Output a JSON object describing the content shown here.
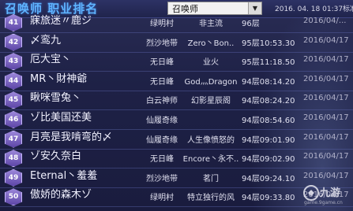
{
  "header": {
    "title": "召唤师 职业排名",
    "dropdown_value": "召唤师",
    "datetime": "2016. 04. 18 01:37标准"
  },
  "rows": [
    {
      "rank": "41",
      "name": "寐旅迷〃鹿ジ",
      "job": "绿明村",
      "cat": "非主流",
      "floor": "96层",
      "date": "2016/04/..."
    },
    {
      "rank": "42",
      "name": "〆鸾九",
      "job": "烈沙地带",
      "cat": "Zero丶Bon..",
      "floor": "95层10:53.30",
      "date": "2016/04/17"
    },
    {
      "rank": "43",
      "name": "厄大宝丶",
      "job": "无日峰",
      "cat": "业火",
      "floor": "95层11:18.50",
      "date": "2016/04/17"
    },
    {
      "rank": "44",
      "name": "MR丶財神爺",
      "job": "无日峰",
      "cat": "God灬Dragon",
      "floor": "94层08:14.20",
      "date": "2016/04/17"
    },
    {
      "rank": "45",
      "name": "瞅咪雪兔丶",
      "job": "白云神师",
      "cat": "幻影星辰阁",
      "floor": "94层08:24.20",
      "date": "2016/04/17"
    },
    {
      "rank": "46",
      "name": "ゾ比美国还美",
      "job": "仙履奇缘",
      "cat": "",
      "floor": "94层08:54.60",
      "date": "2016/04/17"
    },
    {
      "rank": "47",
      "name": "月亮是我啃弯的〆",
      "job": "仙履奇缘",
      "cat": "人生像愤怒的",
      "floor": "94层09:01.90",
      "date": "2016/04/17"
    },
    {
      "rank": "48",
      "name": "ゾ安久奈白",
      "job": "无日峰",
      "cat": "Encore丶永不..",
      "floor": "94层09:02.90",
      "date": "2016/04/17"
    },
    {
      "rank": "49",
      "name": "Eternal丶羞羞",
      "job": "烈沙地带",
      "cat": "茗门",
      "floor": "94层09:24.10",
      "date": "2016/04/17"
    },
    {
      "rank": "50",
      "name": "傲娇的森木ゾ",
      "job": "绿明村",
      "cat": "特立独行的风",
      "floor": "94层09:33.80",
      "date": "2016/04/17"
    }
  ],
  "watermark": {
    "brand": "九游",
    "site": "game.9game.cn"
  },
  "colors": {
    "title": "#5fb4ff",
    "background": "#1b1f3f",
    "badge": "#7a63c4"
  }
}
